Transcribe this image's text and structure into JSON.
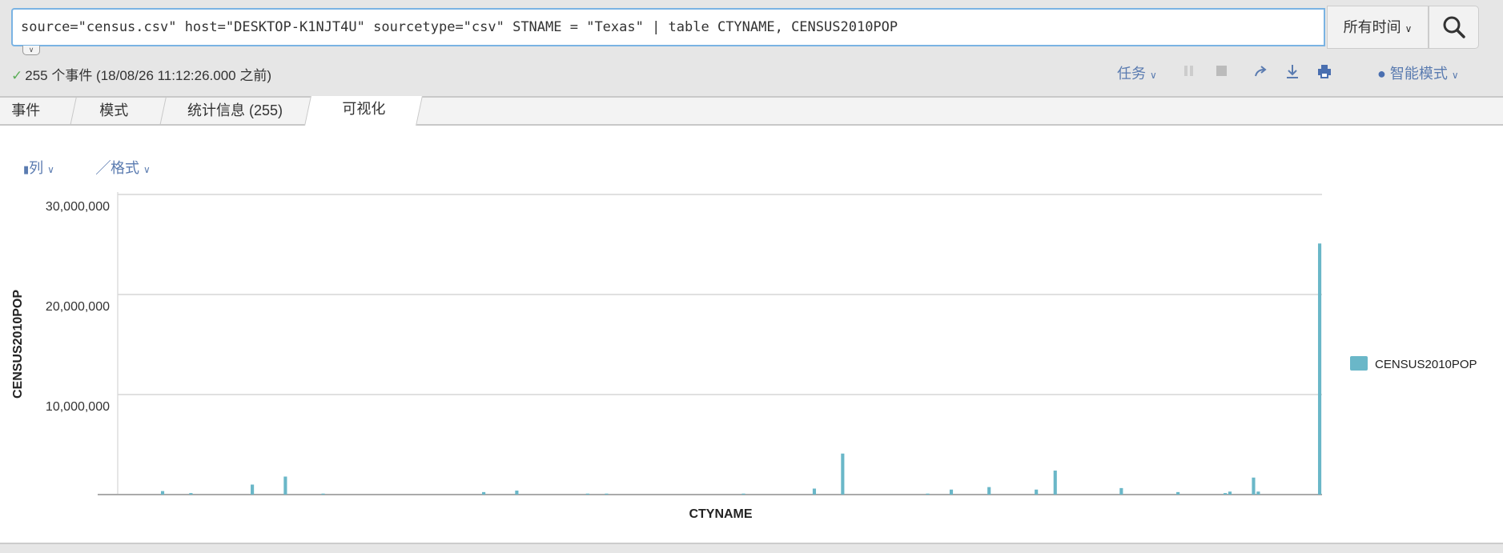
{
  "search": {
    "query": "source=\"census.csv\" host=\"DESKTOP-K1NJT4U\" sourcetype=\"csv\" STNAME = \"Texas\" | table CTYNAME, CENSUS2010POP",
    "time_range": "所有时间",
    "search_icon": "search-icon"
  },
  "status": {
    "check": "✓",
    "text": "255 个事件 (18/08/26 11:12:26.000 之前)"
  },
  "actions": {
    "job": "任务",
    "smart_mode": "智能模式"
  },
  "tabs": [
    {
      "label": "事件"
    },
    {
      "label": "模式"
    },
    {
      "label": "统计信息 (255)"
    },
    {
      "label": "可视化",
      "active": true
    }
  ],
  "viz_controls": {
    "columns": "列",
    "format": "格式"
  },
  "colors": {
    "bar": "#6ab7c8",
    "accent": "#5a7bb0",
    "focus": "#7ab3e3"
  },
  "chart_data": {
    "type": "bar",
    "xlabel": "CTYNAME",
    "ylabel": "CENSUS2010POP",
    "ylim": [
      0,
      30000000
    ],
    "yticks": [
      10000000,
      20000000,
      30000000
    ],
    "ytick_labels": [
      "10,000,000",
      "20,000,000",
      "30,000,000"
    ],
    "grid": true,
    "legend": {
      "position": "right",
      "entries": [
        "CENSUS2010POP"
      ]
    },
    "category_count": 255,
    "series": [
      {
        "name": "CENSUS2010POP",
        "points": [
          {
            "index": 9,
            "value": 350000
          },
          {
            "index": 15,
            "value": 150000
          },
          {
            "index": 28,
            "value": 1000000
          },
          {
            "index": 35,
            "value": 1800000
          },
          {
            "index": 43,
            "value": 100000
          },
          {
            "index": 77,
            "value": 250000
          },
          {
            "index": 84,
            "value": 400000
          },
          {
            "index": 99,
            "value": 100000
          },
          {
            "index": 103,
            "value": 100000
          },
          {
            "index": 132,
            "value": 100000
          },
          {
            "index": 147,
            "value": 600000
          },
          {
            "index": 153,
            "value": 4100000
          },
          {
            "index": 171,
            "value": 100000
          },
          {
            "index": 176,
            "value": 500000
          },
          {
            "index": 184,
            "value": 750000
          },
          {
            "index": 194,
            "value": 500000
          },
          {
            "index": 198,
            "value": 2400000
          },
          {
            "index": 212,
            "value": 650000
          },
          {
            "index": 224,
            "value": 250000
          },
          {
            "index": 234,
            "value": 150000
          },
          {
            "index": 235,
            "value": 300000
          },
          {
            "index": 240,
            "value": 1700000
          },
          {
            "index": 241,
            "value": 300000
          },
          {
            "index": 254,
            "value": 25100000
          }
        ]
      }
    ]
  }
}
